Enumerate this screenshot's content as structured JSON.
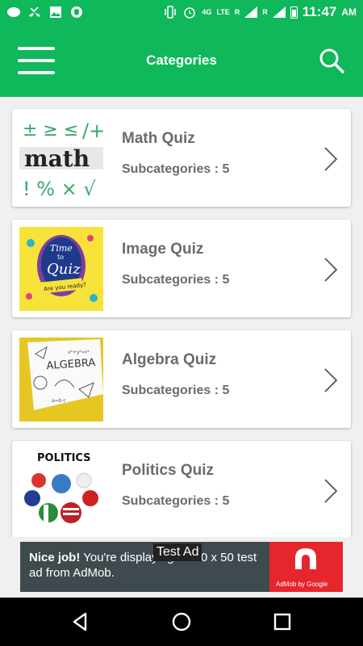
{
  "status_bar": {
    "time": "11:47",
    "ampm": "AM",
    "network": "4G",
    "network_type": "LTE",
    "roaming1": "R",
    "roaming2": "R"
  },
  "toolbar": {
    "title": "Categories"
  },
  "categories": [
    {
      "title": "Math Quiz",
      "subtitle": "Subcategories : 5",
      "thumb_label": "math"
    },
    {
      "title": "Image Quiz",
      "subtitle": "Subcategories : 5",
      "thumb_label": "Time to Quiz"
    },
    {
      "title": "Algebra Quiz",
      "subtitle": "Subcategories : 5",
      "thumb_label": "ALGEBRA"
    },
    {
      "title": "Politics Quiz",
      "subtitle": "Subcategories : 5",
      "thumb_label": "POLITICS"
    }
  ],
  "ad": {
    "headline": "Nice job!",
    "body": " You're displaying a 320 x 50 test ad from AdMob.",
    "brand": "AdMob by Google",
    "badge": "Test Ad"
  },
  "colors": {
    "primary": "#0fb85a",
    "ad_red": "#e5262c"
  }
}
